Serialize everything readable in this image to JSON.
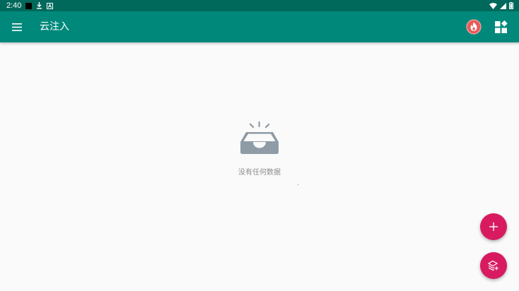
{
  "status_bar": {
    "time": "2:40",
    "icons": [
      "notification-black-icon",
      "download-icon",
      "font-icon",
      "wifi-icon",
      "signal-icon",
      "battery-icon"
    ]
  },
  "app_bar": {
    "title": "云注入",
    "menu_icon": "menu-icon",
    "actions": [
      "fire-icon",
      "widgets-icon"
    ]
  },
  "empty_state": {
    "icon": "empty-inbox-icon",
    "message": "没有任何数据"
  },
  "fabs": [
    {
      "icon": "add-icon"
    },
    {
      "icon": "layers-add-icon"
    }
  ],
  "colors": {
    "status_bar": "#00695c",
    "app_bar": "#00897b",
    "fab": "#d81b60",
    "fire_badge": "#e65c5c",
    "empty_icon": "#8f9ba6",
    "background": "#fafafa"
  }
}
